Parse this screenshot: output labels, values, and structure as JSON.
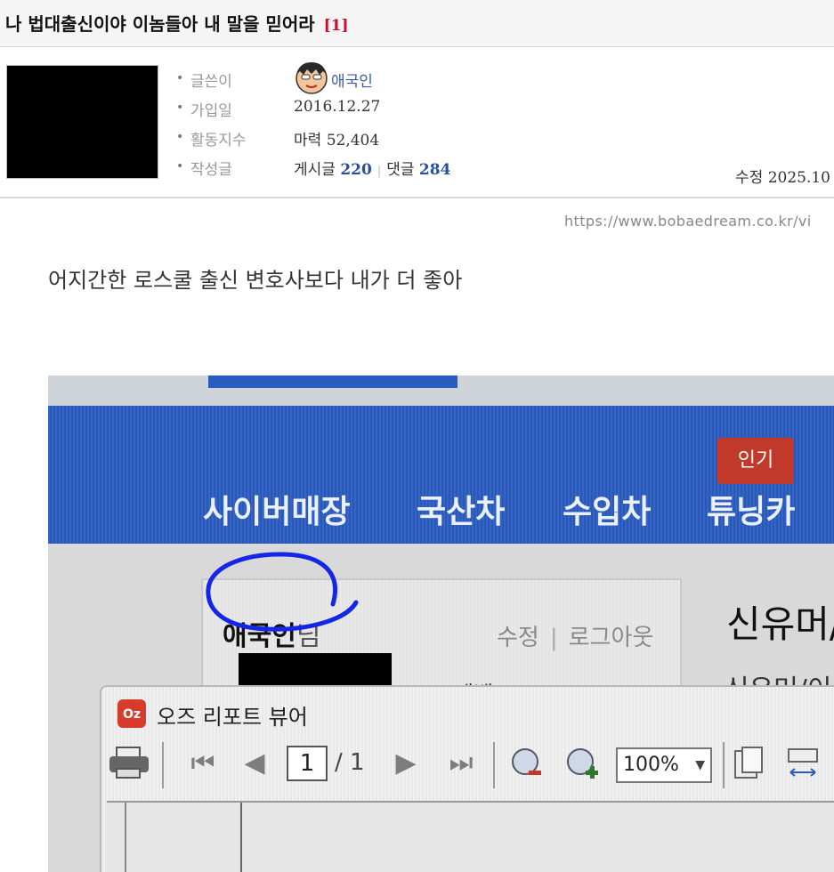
{
  "post": {
    "title": "나 법대출신이야 이놈들아 내 말을 믿어라",
    "comment_count": "[1]"
  },
  "author": {
    "fields": [
      {
        "label": "글쓴이",
        "value": "애국인"
      },
      {
        "label": "가입일",
        "value": "2016.12.27"
      },
      {
        "label": "활동지수",
        "value_label": "마력",
        "value": "52,404"
      },
      {
        "label": "작성글",
        "posts_label": "게시글",
        "posts": "220",
        "comments_label": "댓글",
        "comments": "284"
      }
    ],
    "edited_label": "수정",
    "edited_date": "2025.10"
  },
  "source_url": "https://www.bobaedream.co.kr/vi",
  "body_text": "어지간한 로스쿨 출신 변호사보다 내가 더 좋아",
  "photo": {
    "nav_items": [
      "사이버매장",
      "국산차",
      "수입차",
      "튜닝카"
    ],
    "hot_badge": "인기",
    "username": "애국인",
    "honorific": "님",
    "edit_link": "수정",
    "logout_link": "로그아웃",
    "level_label": "레벨",
    "side_title": "신유머/",
    "side_subtitle": "신유머/이",
    "viewer": {
      "logo": "Oz",
      "title": "오즈 리포트 뷰어",
      "current_page": "1",
      "total_pages": "/ 1",
      "zoom": "100%"
    }
  },
  "colors": {
    "comment_count": "#c8102e",
    "nickname": "#3a5bb5",
    "counts": "#2a4f9e",
    "site_nav": "#2a5cc0",
    "circle_annotation": "#1426e6"
  }
}
